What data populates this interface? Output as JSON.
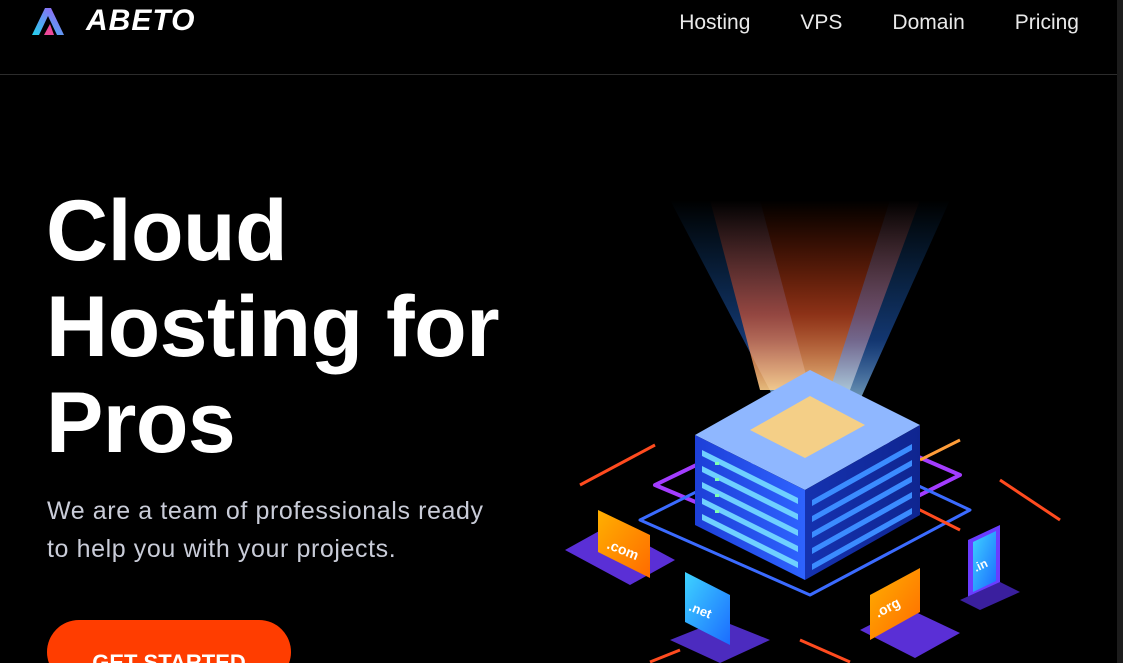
{
  "header": {
    "brand": "ABETO",
    "nav": [
      "Hosting",
      "VPS",
      "Domain",
      "Pricing"
    ]
  },
  "hero": {
    "title_lines": [
      "Cloud",
      "Hosting for",
      "Pros"
    ],
    "subtitle_lines": [
      "We are a team of professionals ready",
      "to help you with your projects."
    ],
    "cta": "GET STARTED"
  },
  "illustration": {
    "domains": [
      ".com",
      ".net",
      ".org",
      ".in"
    ]
  },
  "colors": {
    "background": "#000000",
    "cta": "#ff3d00",
    "logo_gradient_start": "#22d3ee",
    "logo_gradient_end": "#a855f7"
  }
}
